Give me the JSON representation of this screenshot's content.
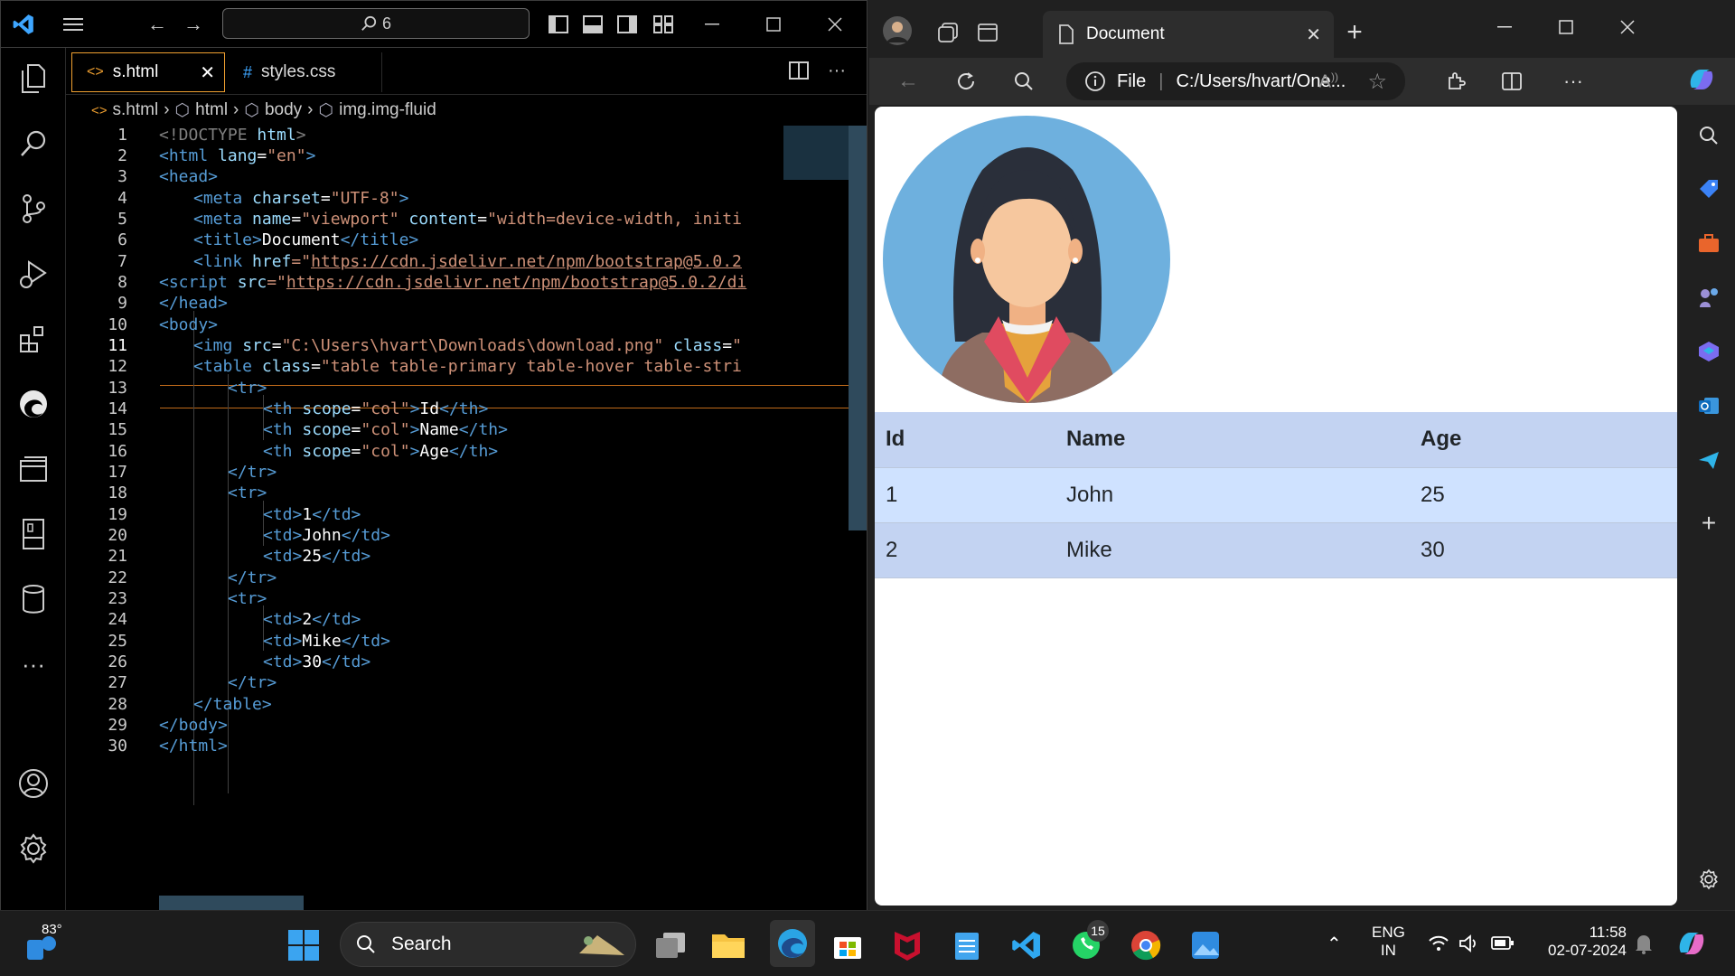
{
  "vscode": {
    "command_center": "6",
    "tabs": [
      {
        "label": "s.html",
        "icon": "html-file-icon",
        "active": true
      },
      {
        "label": "styles.css",
        "icon": "css-file-icon",
        "active": false
      }
    ],
    "breadcrumb": [
      "s.html",
      "html",
      "body",
      "img.img-fluid"
    ],
    "current_line": 11,
    "line_numbers": [
      "1",
      "2",
      "3",
      "4",
      "5",
      "6",
      "7",
      "8",
      "9",
      "10",
      "11",
      "12",
      "13",
      "14",
      "15",
      "16",
      "17",
      "18",
      "19",
      "20",
      "21",
      "22",
      "23",
      "24",
      "25",
      "26",
      "27",
      "28",
      "29",
      "30"
    ],
    "code": {
      "l1_a": "<!DOCTYPE",
      "l1_b": " html",
      "l1_c": ">",
      "l2_tag": "<html",
      "l2_attr": " lang",
      "l2_eq": "=",
      "l2_val": "\"en\"",
      "l2_end": ">",
      "l3": "<head>",
      "l4_tag": "<meta",
      "l4_attr": " charset",
      "l4_eq": "=",
      "l4_val": "\"UTF-8\"",
      "l4_end": ">",
      "l5_tag": "<meta",
      "l5_attr": " name",
      "l5_eq": "=",
      "l5_val": "\"viewport\"",
      "l5_attr2": " content",
      "l5_eq2": "=",
      "l5_val2": "\"width=device-width, initi",
      "l6_tag": "<title>",
      "l6_text": "Document",
      "l6_end": "</title>",
      "l7_tag": "<link",
      "l7_attr": " href",
      "l7_eq": "=\"",
      "l7_url": "https://cdn.jsdelivr.net/npm/bootstrap@5.0.2",
      "l8_tag": "<script",
      "l8_attr": " src",
      "l8_eq": "=\"",
      "l8_url": "https://cdn.jsdelivr.net/npm/bootstrap@5.0.2/di",
      "l9": "</head>",
      "l10": "<body>",
      "l11_tag": "<img",
      "l11_attr": " src",
      "l11_eq": "=",
      "l11_val": "\"C:\\Users\\hvart\\Downloads\\download.png\"",
      "l11_attr2": " class",
      "l11_eq2": "=",
      "l11_val2": "\"",
      "l12_tag": "<table",
      "l12_attr": " class",
      "l12_eq": "=",
      "l12_val": "\"table table-primary table-hover table-stri",
      "l13": "<tr>",
      "l14_tag": "<th",
      "l14_attr": " scope",
      "l14_eq": "=",
      "l14_val": "\"col\"",
      "l14_gt": ">",
      "l14_text": "Id",
      "l14_end": "</th>",
      "l15_tag": "<th",
      "l15_attr": " scope",
      "l15_eq": "=",
      "l15_val": "\"col\"",
      "l15_gt": ">",
      "l15_text": "Name",
      "l15_end": "</th>",
      "l16_tag": "<th",
      "l16_attr": " scope",
      "l16_eq": "=",
      "l16_val": "\"col\"",
      "l16_gt": ">",
      "l16_text": "Age",
      "l16_end": "</th>",
      "l17": "</tr>",
      "l18": "<tr>",
      "l19_tag": "<td>",
      "l19_text": "1",
      "l19_end": "</td>",
      "l20_tag": "<td>",
      "l20_text": "John",
      "l20_end": "</td>",
      "l21_tag": "<td>",
      "l21_text": "25",
      "l21_end": "</td>",
      "l22": "</tr>",
      "l23": "<tr>",
      "l24_tag": "<td>",
      "l24_text": "2",
      "l24_end": "</td>",
      "l25_tag": "<td>",
      "l25_text": "Mike",
      "l25_end": "</td>",
      "l26_tag": "<td>",
      "l26_text": "30",
      "l26_end": "</td>",
      "l27": "</tr>",
      "l28": "</table>",
      "l29": "</body>",
      "l30": "</html>"
    }
  },
  "browser": {
    "tab_title": "Document",
    "address_scheme": "File",
    "address": "C:/Users/hvart/One...",
    "table": {
      "headers": [
        "Id",
        "Name",
        "Age"
      ],
      "rows": [
        [
          "1",
          "John",
          "25"
        ],
        [
          "2",
          "Mike",
          "30"
        ]
      ]
    }
  },
  "taskbar": {
    "weather": "83°",
    "search_label": "Search",
    "whatsapp_badge": "15",
    "lang": "ENG",
    "region": "IN",
    "time": "11:58",
    "date": "02-07-2024"
  },
  "colors": {
    "accent_orange": "#f0a030",
    "table_header": "#c3d3f2",
    "table_row": "#cfe2ff",
    "avatar_bg": "#6eb0de"
  }
}
